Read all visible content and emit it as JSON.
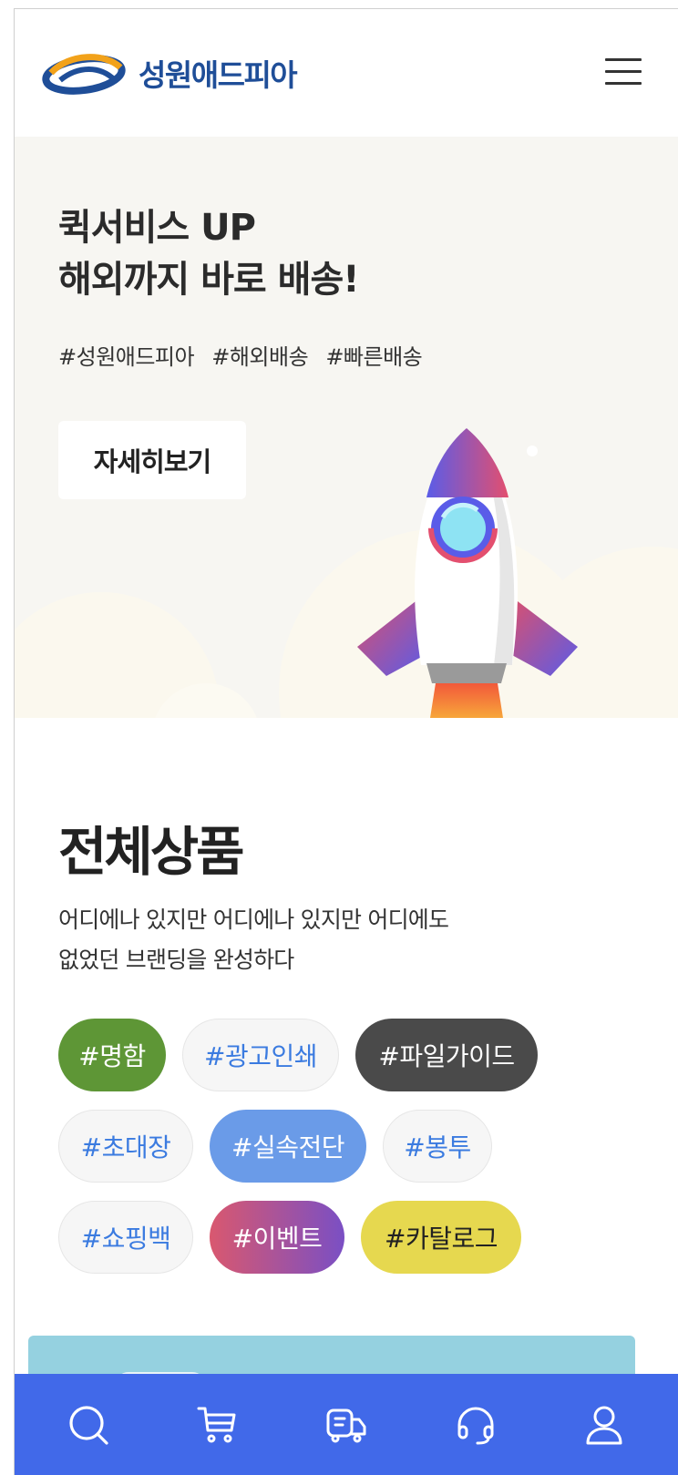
{
  "header": {
    "logo_text": "성원애드피아",
    "menu_icon": "hamburger-menu-icon"
  },
  "hero": {
    "title_line1": "퀵서비스 UP",
    "title_line2": "해외까지 바로 배송!",
    "tags": [
      "#성원애드피아",
      "#해외배송",
      "#빠른배송"
    ],
    "detail_button": "자세히보기",
    "illustration": "rocket-icon"
  },
  "products": {
    "title": "전체상품",
    "desc_line1": "어디에나 있지만 어디에나 있지만 어디에도",
    "desc_line2": "없었던 브랜딩을 완성하다",
    "chips": [
      {
        "label": "#명함",
        "color": "#5e9636"
      },
      {
        "label": "#광고인쇄",
        "color": "#f6f6f6"
      },
      {
        "label": "#파일가이드",
        "color": "#4a4a4a"
      },
      {
        "label": "#초대장",
        "color": "#f6f6f6"
      },
      {
        "label": "#실속전단",
        "color": "#6a9be8"
      },
      {
        "label": "#봉투",
        "color": "#f6f6f6"
      },
      {
        "label": "#쇼핑백",
        "color": "#f6f6f6"
      },
      {
        "label": "#이벤트",
        "color": "#d9586f"
      },
      {
        "label": "#카탈로그",
        "color": "#e6d84f"
      }
    ]
  },
  "bottom_nav": {
    "background": "#4169e9",
    "items": [
      {
        "icon": "search-icon"
      },
      {
        "icon": "cart-icon"
      },
      {
        "icon": "delivery-truck-icon"
      },
      {
        "icon": "headset-icon"
      },
      {
        "icon": "user-icon"
      }
    ]
  },
  "colors": {
    "brand_blue": "#1f4e98",
    "hero_bg": "#f7f6f2",
    "link_blue": "#3b7be0",
    "banner_bg": "#95d1e0"
  }
}
